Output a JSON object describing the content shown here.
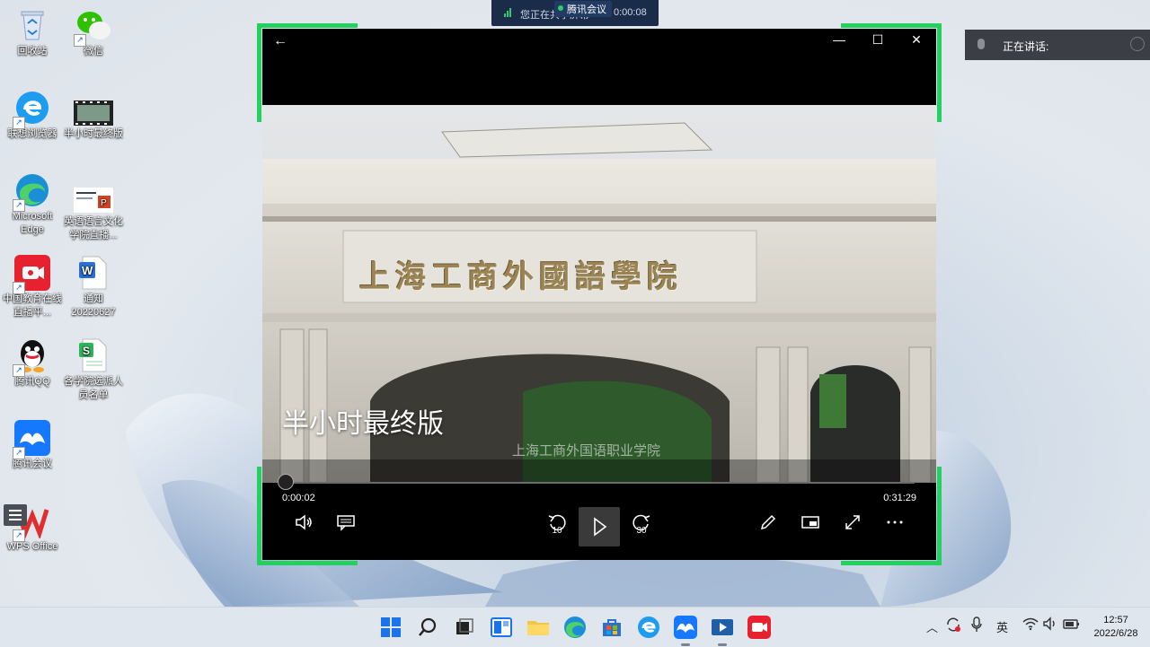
{
  "desktop": {
    "icons": [
      {
        "label": "回收站"
      },
      {
        "label": "微信"
      },
      {
        "label": "联想浏览器"
      },
      {
        "label": "半小时最终版"
      },
      {
        "label": "Microsoft Edge"
      },
      {
        "label": "英语语言文化学院直播..."
      },
      {
        "label": "中国教育在线直播平..."
      },
      {
        "label": "通知 20220627"
      },
      {
        "label": "腾讯QQ"
      },
      {
        "label": "各学院选派人员名单"
      },
      {
        "label": "腾讯会议"
      },
      {
        "label": "WPS Office"
      }
    ]
  },
  "meeting_bar": {
    "status_text": "您正在共享屏幕",
    "tag": "腾讯会议",
    "elapsed": "0:00:08"
  },
  "speaking_panel": {
    "label": "正在讲话:"
  },
  "player": {
    "video_title": "半小时最终版",
    "video_subtitle": "上海工商外国语职业学院",
    "building_sign": "上海工商外國語學院",
    "current_time": "0:00:02",
    "total_time": "0:31:29",
    "progress_fraction": 0.001,
    "skip_back_seconds": "10",
    "skip_forward_seconds": "30"
  },
  "clock": {
    "time": "12:57",
    "date": "2022/6/28"
  },
  "tray": {
    "ime": "英"
  },
  "colors": {
    "share_border": "#22d15e",
    "player_bg": "#000000",
    "taskbar_bg": "#dfe6ee"
  }
}
